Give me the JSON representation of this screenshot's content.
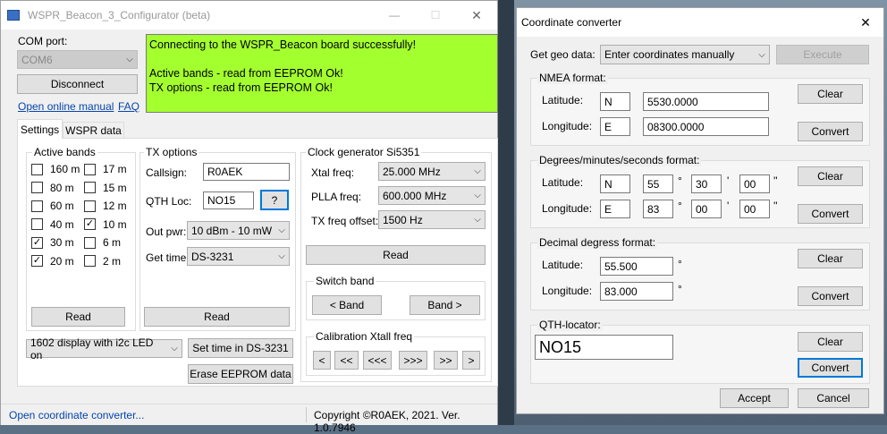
{
  "main_window": {
    "title": "WSPR_Beacon_3_Configurator (beta)",
    "com_port_label": "COM port:",
    "com_port_value": "COM6",
    "disconnect_button": "Disconnect",
    "open_manual_link": "Open online manual",
    "faq_link": "FAQ",
    "log_lines": [
      "Connecting to the WSPR_Beacon board successfully!",
      "",
      "Active bands - read from EEPROM Ok!",
      "TX options - read from EEPROM Ok!"
    ],
    "log_bg_color": "#a4ff2f",
    "tabs": [
      "Settings",
      "WSPR data"
    ],
    "active_bands": {
      "label": "Active bands",
      "bands": [
        {
          "label": "160 m",
          "checked": false
        },
        {
          "label": "17 m",
          "checked": false
        },
        {
          "label": "80 m",
          "checked": false
        },
        {
          "label": "15 m",
          "checked": false
        },
        {
          "label": "60 m",
          "checked": false
        },
        {
          "label": "12 m",
          "checked": false
        },
        {
          "label": "40 m",
          "checked": false
        },
        {
          "label": "10 m",
          "checked": true
        },
        {
          "label": "30 m",
          "checked": true
        },
        {
          "label": "6 m",
          "checked": false
        },
        {
          "label": "20 m",
          "checked": true
        },
        {
          "label": "2 m",
          "checked": false
        }
      ],
      "read_button": "Read"
    },
    "tx_options": {
      "label": "TX options",
      "callsign_label": "Callsign:",
      "callsign_value": "R0AEK",
      "qth_label": "QTH Loc:",
      "qth_value": "NO15",
      "qth_help_button": "?",
      "out_pwr_label": "Out pwr:",
      "out_pwr_value": "10 dBm - 10 mW",
      "get_time_label": "Get time:",
      "get_time_value": "DS-3231",
      "read_button": "Read"
    },
    "clock_gen": {
      "label": "Clock generator Si5351",
      "xtal_label": "Xtal freq:",
      "xtal_value": "25.000 MHz",
      "plla_label": "PLLA freq:",
      "plla_value": "600.000 MHz",
      "txoff_label": "TX freq offset:",
      "txoff_value": "1500 Hz",
      "read_button": "Read",
      "switch_band_label": "Switch band",
      "band_prev": "< Band",
      "band_next": "Band >",
      "calib_label": "Calibration Xtall freq",
      "calib_buttons": [
        "<",
        "<<",
        "<<<",
        ">>>",
        ">>",
        ">"
      ]
    },
    "display_select": "1602 display with i2c LED on",
    "set_time_button": "Set time in DS-3231",
    "erase_button": "Erase EEPROM data",
    "status_link": "Open coordinate converter...",
    "status_copyright": "Copyright ©R0AEK, 2021. Ver. 1.0.7946"
  },
  "converter": {
    "title": "Coordinate converter",
    "close": "✕",
    "geo_label": "Get geo data:",
    "geo_select": "Enter coordinates manually",
    "execute_button": "Execute",
    "nmea": {
      "label": "NMEA format:",
      "lat_label": "Latitude:",
      "lat_dir": "N",
      "lat_value": "5530.0000",
      "lon_label": "Longitude:",
      "lon_dir": "E",
      "lon_value": "08300.0000"
    },
    "dms": {
      "label": "Degrees/minutes/seconds format:",
      "lat_label": "Latitude:",
      "lat_dir": "N",
      "lat_d": "55",
      "lat_m": "30",
      "lat_s": "00",
      "lon_label": "Longitude:",
      "lon_dir": "E",
      "lon_d": "83",
      "lon_m": "00",
      "lon_s": "00",
      "deg_sym": "°",
      "min_sym": "'",
      "sec_sym": "''"
    },
    "dec": {
      "label": "Decimal degress format:",
      "lat_label": "Latitude:",
      "lat_value": "55.500",
      "lon_label": "Longitude:",
      "lon_value": "83.000",
      "deg_sym": "°"
    },
    "qth": {
      "label": "QTH-locator:",
      "value": "NO15"
    },
    "clear_button": "Clear",
    "convert_button": "Convert",
    "accept_button": "Accept",
    "cancel_button": "Cancel"
  }
}
